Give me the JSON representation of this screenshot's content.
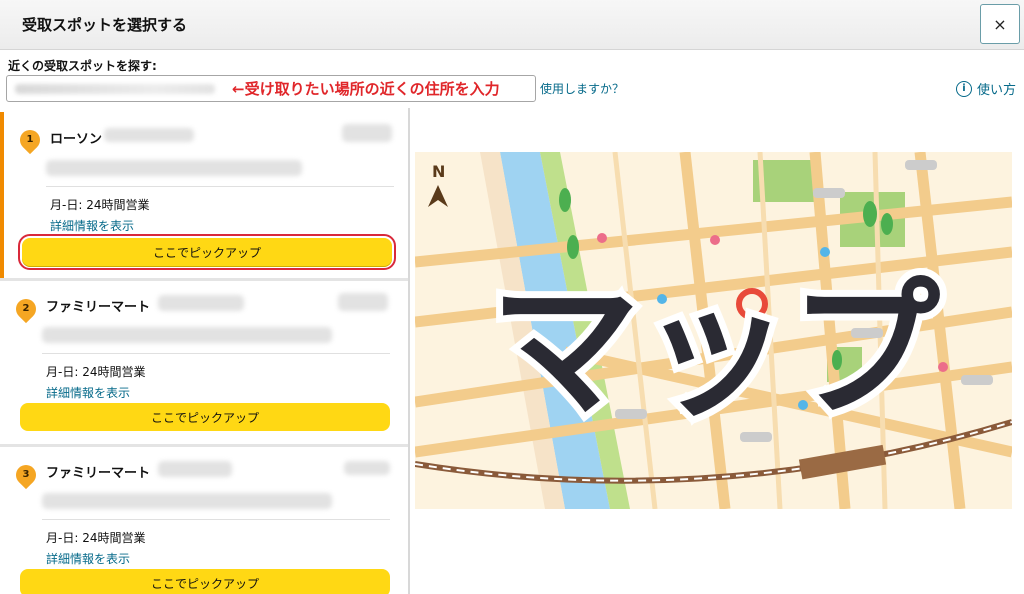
{
  "header": {
    "title": "受取スポットを選択する",
    "close_label": "×"
  },
  "search": {
    "label": "近くの受取スポットを探す:",
    "annotation": "←受け取りたい場所の近くの住所を入力",
    "question_text": "使用しますか？",
    "help_label": "使い方",
    "help_icon": "info-icon"
  },
  "spots": [
    {
      "number": "1",
      "name": "ローソン",
      "hours": "月-日: 24時間営業",
      "details_link": "詳細情報を表示",
      "button_label": "ここでピックアップ"
    },
    {
      "number": "2",
      "name": "ファミリーマート",
      "hours": "月-日: 24時間営業",
      "details_link": "詳細情報を表示",
      "button_label": "ここでピックアップ"
    },
    {
      "number": "3",
      "name": "ファミリーマート",
      "hours": "月-日: 24時間営業",
      "details_link": "詳細情報を表示",
      "button_label": "ここでピックアップ"
    }
  ],
  "map": {
    "label": "マップ",
    "compass": "N"
  },
  "colors": {
    "accent": "#f08a00",
    "button": "#ffd814",
    "link": "#066a8a",
    "annotation": "#e0262a"
  }
}
